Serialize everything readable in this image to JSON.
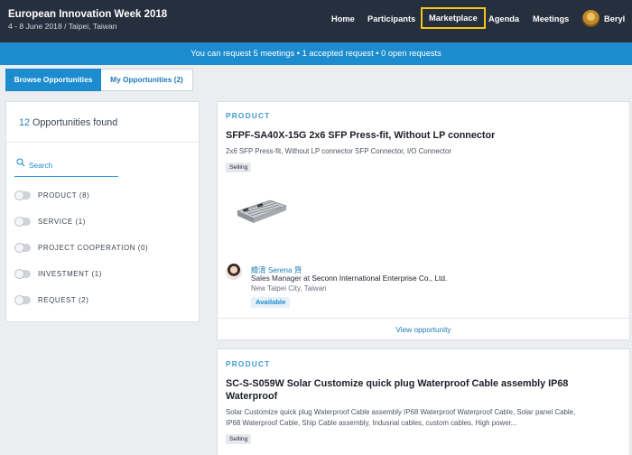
{
  "header": {
    "event_title": "European Innovation Week 2018",
    "event_subtitle": "4 - 8 June 2018 / Taipei, Taiwan",
    "nav": [
      "Home",
      "Participants",
      "Marketplace",
      "Agenda",
      "Meetings"
    ],
    "active_nav": "Marketplace",
    "user_name": "Beryl",
    "accent_color": "#f5c518"
  },
  "info_bar": {
    "text": "You can request 5 meetings • 1 accepted request • 0 open requests",
    "color": "#1d8ccf"
  },
  "tabs": {
    "browse": "Browse Opportunities",
    "mine": "My Opportunities (2)"
  },
  "filters": {
    "count": "12",
    "found_label": " Opportunities found",
    "search_placeholder": "Search",
    "items": [
      {
        "label": "PRODUCT (8)"
      },
      {
        "label": "SERVICE (1)"
      },
      {
        "label": "PROJECT COOPERATION (0)"
      },
      {
        "label": "INVESTMENT (1)"
      },
      {
        "label": "REQUEST (2)"
      }
    ]
  },
  "cards": [
    {
      "kicker": "PRODUCT",
      "title": "SFPF-SA40X-15G 2x6 SFP Press-fit, Without LP connector",
      "description": "2x6 SFP Press-fit, Without LP connector SFP Connector, I/O Connector",
      "badge": "Selling",
      "person_name": "繪淯 Serena 齊",
      "person_role": "Sales Manager at ",
      "person_company": "Seconn International Enterprise Co., Ltd.",
      "person_location": "New Taipei City, Taiwan",
      "status": "Available",
      "link": "View opportunity"
    },
    {
      "kicker": "PRODUCT",
      "title": "SC-S-S059W Solar Customize quick plug Waterproof Cable assembly IP68 Waterproof",
      "description": "Solar Customize quick plug Waterproof Cable assembly IP68 Waterproof Waterproof Cable, Solar panel Cable, IP68 Waterproof Cable, Ship Cable assembly, Indusrial cables, custom cables, High power...",
      "badge": "Selling"
    }
  ]
}
